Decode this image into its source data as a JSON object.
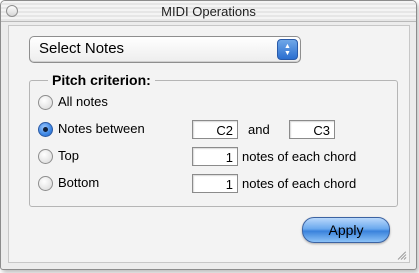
{
  "window": {
    "title": "MIDI Operations"
  },
  "operation_popup": {
    "selected": "Select Notes"
  },
  "pitch_group": {
    "title": "Pitch criterion:",
    "options": [
      {
        "label": "All notes",
        "selected": false
      },
      {
        "label": "Notes between",
        "selected": true
      },
      {
        "label": "Top",
        "selected": false
      },
      {
        "label": "Bottom",
        "selected": false
      }
    ],
    "between_low": "C2",
    "between_and": "and",
    "between_high": "C3",
    "top_count": "1",
    "bottom_count": "1",
    "notes_suffix": "notes of each chord"
  },
  "apply_button": {
    "label": "Apply"
  },
  "colors": {
    "apply_blue": "#3a82dc",
    "radio_selected": "#3e87e4"
  }
}
